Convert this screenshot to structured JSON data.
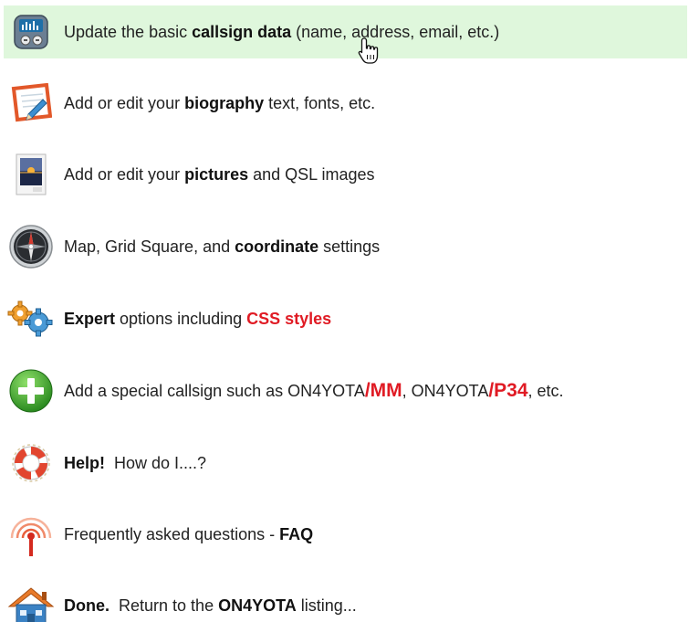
{
  "items": [
    {
      "icon": "control-panel-icon",
      "pre": "Update the basic ",
      "bold": "callsign data",
      "post": " (name, address, email, etc.)"
    },
    {
      "icon": "edit-notepad-icon",
      "pre": "Add or edit your ",
      "bold": "biography",
      "post": " text, fonts, etc."
    },
    {
      "icon": "picture-icon",
      "pre": "Add or edit your ",
      "bold": "pictures",
      "post": " and QSL images"
    },
    {
      "icon": "compass-icon",
      "pre": "Map, Grid Square, and ",
      "bold": "coordinate",
      "post": " settings"
    },
    {
      "icon": "gears-icon",
      "bold": "Expert",
      "mid": " options including ",
      "red": "CSS styles"
    },
    {
      "icon": "add-plus-icon",
      "pre": "Add a special callsign such as ON4YOTA",
      "red1": "/MM",
      "mid": ", ON4YOTA",
      "red2": "/P34",
      "post": ", etc."
    },
    {
      "icon": "lifebuoy-icon",
      "bold": "Help!",
      "post": "How do I....?"
    },
    {
      "icon": "antenna-tower-icon",
      "pre": "Frequently asked questions - ",
      "bold": "FAQ"
    },
    {
      "icon": "home-icon",
      "bold": "Done.",
      "mid": "Return to the ",
      "bold2": "ON4YOTA",
      "post": " listing..."
    }
  ],
  "colors": {
    "highlight": "#dff7dc",
    "accent_red": "#e01b24"
  },
  "cursor_icon": "hand-pointer-icon"
}
